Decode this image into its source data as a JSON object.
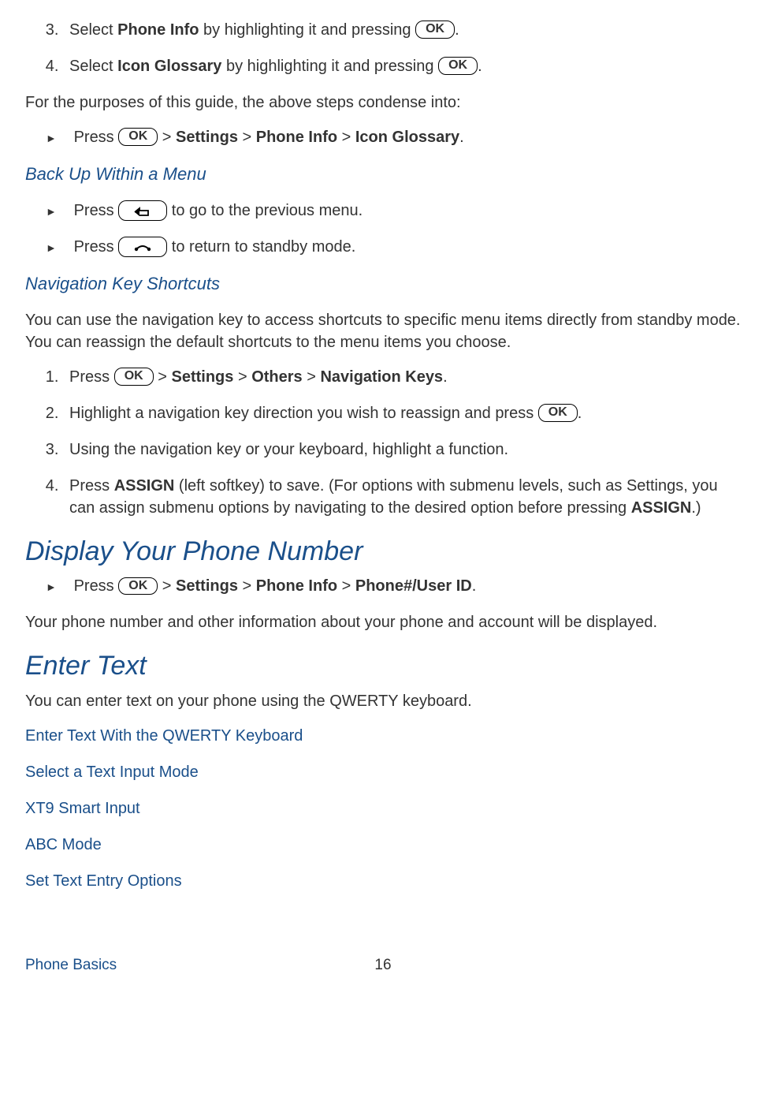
{
  "step3": {
    "num": "3.",
    "a": "Select ",
    "b": "Phone Info",
    "c": " by highlighting it and pressing ",
    "ok": "OK",
    "d": "."
  },
  "step4": {
    "num": "4.",
    "a": "Select ",
    "b": "Icon Glossary",
    "c": " by highlighting it and pressing ",
    "ok": "OK",
    "d": "."
  },
  "condense_intro": "For the purposes of this guide, the above steps condense into:",
  "condense_bullet": {
    "a": "Press ",
    "ok": "OK",
    "gt": " > ",
    "p1": "Settings",
    "p2": "Phone Info",
    "p3": "Icon Glossary",
    "d": "."
  },
  "backup_heading": "Back Up Within a Menu",
  "backup_b1": {
    "a": "Press ",
    "b": " to go to the previous menu."
  },
  "backup_b2": {
    "a": "Press ",
    "b": " to return to standby mode."
  },
  "navkey_heading": "Navigation Key Shortcuts",
  "navkey_intro": "You can use the navigation key to access shortcuts to specific menu items directly from standby mode. You can reassign the default shortcuts to the menu items you choose.",
  "nk_step1": {
    "num": "1.",
    "a": "Press ",
    "ok": "OK",
    "gt": " > ",
    "p1": "Settings",
    "p2": "Others",
    "p3": "Navigation Keys",
    "d": "."
  },
  "nk_step2": {
    "num": "2.",
    "a": "Highlight a navigation key direction you wish to reassign and press ",
    "ok": "OK",
    "d": "."
  },
  "nk_step3": {
    "num": "3.",
    "a": "Using the navigation key or your keyboard, highlight a function."
  },
  "nk_step4": {
    "num": "4.",
    "a": "Press ",
    "b": "ASSIGN",
    "c": " (left softkey) to save. (For options with submenu levels, such as Settings, you can assign submenu options by navigating to the desired option before pressing ",
    "d": "ASSIGN",
    "e": ".)"
  },
  "display_heading": "Display Your Phone Number",
  "display_bullet": {
    "a": "Press ",
    "ok": "OK",
    "gt": " > ",
    "p1": "Settings",
    "p2": "Phone Info",
    "p3": "Phone#/User ID",
    "d": "."
  },
  "display_note": "Your phone number and other information about your phone and account will be displayed.",
  "enter_heading": "Enter Text",
  "enter_intro": "You can enter text on your phone using the QWERTY keyboard.",
  "links": {
    "l1": "Enter Text With the QWERTY Keyboard",
    "l2": "Select a Text Input Mode",
    "l3": "XT9 Smart Input",
    "l4": "ABC Mode",
    "l5": "Set Text Entry Options"
  },
  "footer": {
    "title": "Phone Basics",
    "page": "16"
  }
}
